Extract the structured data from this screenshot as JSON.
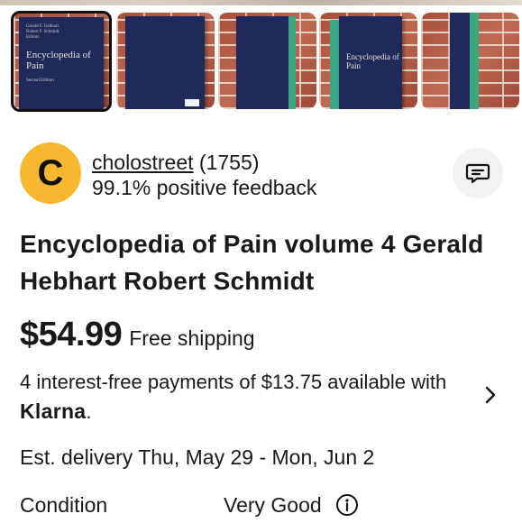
{
  "gallery": {
    "selected_index": 0,
    "thumbnails": [
      {
        "name": "thumbnail-front-cover",
        "cover_text": {
          "authors": "Gerald F. Gebhart\nRobert F. Schmidt\nEditors",
          "title": "Encyclopedia of Pain",
          "edition": "Second Edition"
        }
      },
      {
        "name": "thumbnail-back-cover"
      },
      {
        "name": "thumbnail-side-angle"
      },
      {
        "name": "thumbnail-angled-cover",
        "cover_text": {
          "title": "Encyclopedia of Pain"
        }
      },
      {
        "name": "thumbnail-spine"
      }
    ]
  },
  "seller": {
    "avatar_letter": "C",
    "avatar_color": "#f5b82e",
    "username": "cholostreet",
    "rating_count": "(1755)",
    "feedback": "99.1% positive feedback",
    "message_icon": "chat-bubble-icon"
  },
  "listing": {
    "title": "Encyclopedia of Pain volume 4 Gerald Hebhart Robert Schmidt",
    "price": "$54.99",
    "shipping": "Free shipping",
    "payments_text": "4 interest-free payments of $13.75 available with",
    "payments_brand": "Klarna",
    "payments_suffix": ".",
    "delivery": "Est. delivery Thu, May 29 - Mon, Jun 2",
    "condition_label": "Condition",
    "condition_value": "Very Good"
  },
  "colors": {
    "book_cover": "#1f2a5a",
    "spine_accent": "#3aa883",
    "text": "#191919"
  }
}
